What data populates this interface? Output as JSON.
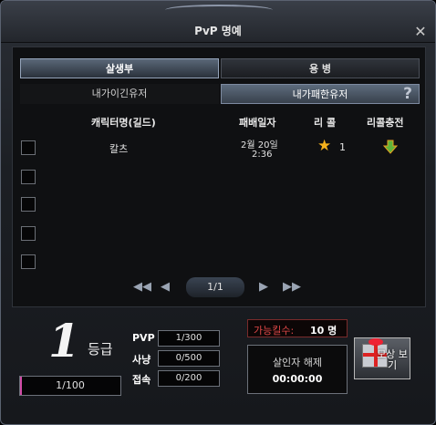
{
  "window": {
    "title": "PvP 명예",
    "close_icon": "close-icon"
  },
  "tabs": {
    "main": [
      "살생부",
      "용 병"
    ],
    "sub": [
      "내가이긴유저",
      "내가패한유저"
    ],
    "help_symbol": "?"
  },
  "table": {
    "headers": [
      "캐릭터명(길드)",
      "패배일자",
      "리 콜",
      "리콜충전"
    ],
    "rows": [
      {
        "name": "칼츠",
        "date": "2월 20일",
        "time": "2:36",
        "recall_count": "1"
      },
      {
        "name": "",
        "date": "",
        "time": "",
        "recall_count": ""
      },
      {
        "name": "",
        "date": "",
        "time": "",
        "recall_count": ""
      },
      {
        "name": "",
        "date": "",
        "time": "",
        "recall_count": ""
      },
      {
        "name": "",
        "date": "",
        "time": "",
        "recall_count": ""
      }
    ]
  },
  "pager": {
    "page": "1/1",
    "icons": [
      "first-page-icon",
      "prev-page-icon",
      "next-page-icon",
      "last-page-icon"
    ]
  },
  "status": {
    "grade_number": "1",
    "grade_label": "등급",
    "exp": "1/100",
    "exp_fraction": 0.01,
    "stats": [
      {
        "label": "PVP",
        "value": "1/300"
      },
      {
        "label": "사냥",
        "value": "0/500"
      },
      {
        "label": "접속",
        "value": "0/200"
      }
    ],
    "kill_label": "가능킬수:",
    "kill_value": "10 명",
    "killer_label": "살인자 해제",
    "killer_time": "00:00:00",
    "gift_button": "모상 보기"
  },
  "colors": {
    "accent_star": "#f5b21c",
    "kill_text": "#e04848",
    "exp_bar": "#d14aa6"
  }
}
